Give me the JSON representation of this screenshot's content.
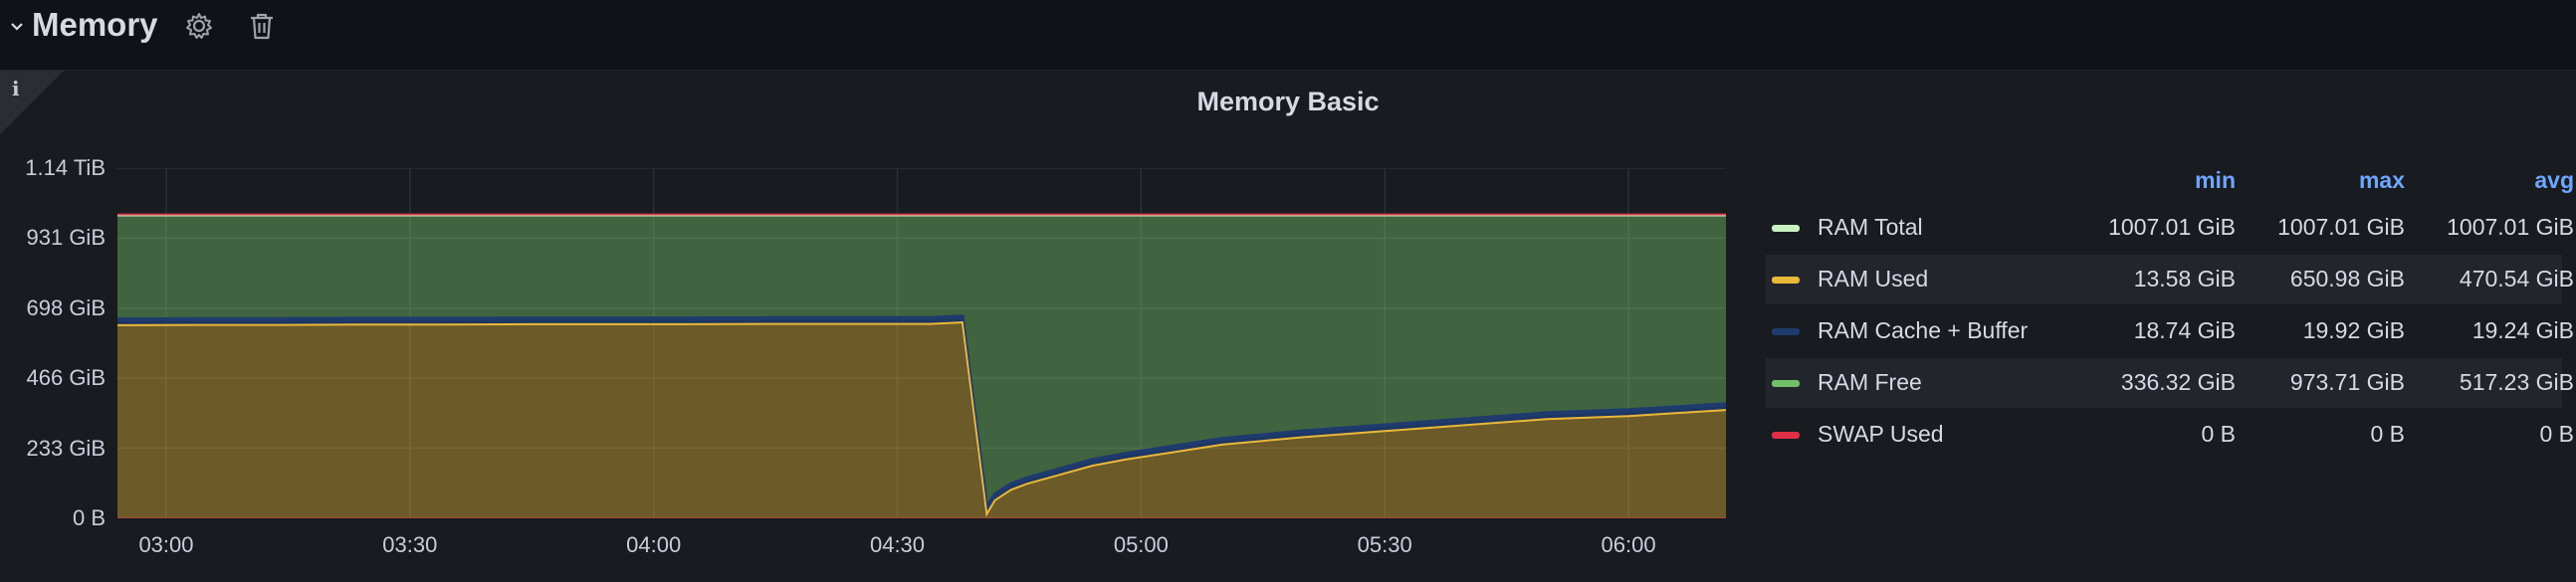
{
  "row": {
    "title": "Memory",
    "collapse_icon": "chevron-down-icon",
    "settings_icon": "gear-icon",
    "delete_icon": "trash-icon"
  },
  "panel": {
    "title": "Memory Basic",
    "info_icon": "info-icon"
  },
  "chart_data": {
    "type": "area",
    "title": "Memory Basic",
    "xlabel": "",
    "ylabel": "",
    "y_ticks": [
      "0 B",
      "233 GiB",
      "466 GiB",
      "698 GiB",
      "931 GiB",
      "1.14 TiB"
    ],
    "y_tick_values": [
      0,
      233,
      466,
      698,
      931,
      1164
    ],
    "ylim": [
      0,
      1164
    ],
    "x_ticks": [
      "03:00",
      "03:30",
      "04:00",
      "04:30",
      "05:00",
      "05:30",
      "06:00"
    ],
    "x_tick_minutes": [
      180,
      210,
      240,
      270,
      300,
      330,
      360
    ],
    "xlim": [
      174,
      372
    ],
    "grid": true,
    "legend_placement": "right-table",
    "x": [
      174,
      184,
      194,
      204,
      214,
      224,
      234,
      244,
      254,
      264,
      274,
      278,
      281,
      282,
      284,
      286,
      290,
      294,
      298,
      304,
      310,
      320,
      330,
      340,
      350,
      360,
      372
    ],
    "series": [
      {
        "name": "RAM Total",
        "color": "#c8f2c2",
        "values": [
          1007.01,
          1007.01,
          1007.01,
          1007.01,
          1007.01,
          1007.01,
          1007.01,
          1007.01,
          1007.01,
          1007.01,
          1007.01,
          1007.01,
          1007.01,
          1007.01,
          1007.01,
          1007.01,
          1007.01,
          1007.01,
          1007.01,
          1007.01,
          1007.01,
          1007.01,
          1007.01,
          1007.01,
          1007.01,
          1007.01,
          1007.01
        ]
      },
      {
        "name": "RAM Used",
        "color": "#eab839",
        "values": [
          642,
          643,
          643,
          644,
          644,
          645,
          645,
          645,
          646,
          646,
          646,
          650.98,
          13.58,
          60,
          95,
          115,
          145,
          175,
          195,
          220,
          245,
          270,
          290,
          310,
          330,
          340,
          360
        ]
      },
      {
        "name": "RAM Cache + Buffer",
        "color": "#1f3b6e",
        "values": [
          19.2,
          19.2,
          19.2,
          19.2,
          19.3,
          19.3,
          19.3,
          19.4,
          19.4,
          19.5,
          19.5,
          19.9,
          18.74,
          18.8,
          18.9,
          19.0,
          19.0,
          19.1,
          19.1,
          19.2,
          19.2,
          19.3,
          19.3,
          19.4,
          19.4,
          19.5,
          19.5
        ]
      },
      {
        "name": "RAM Free",
        "color": "#73bf69",
        "values": [
          346,
          345,
          345,
          344,
          344,
          343,
          343,
          343,
          342,
          342,
          342,
          336.32,
          973.71,
          928,
          893,
          873,
          843,
          813,
          793,
          768,
          743,
          718,
          698,
          678,
          658,
          648,
          628
        ]
      },
      {
        "name": "SWAP Used",
        "color": "#e02f44",
        "values": [
          0,
          0,
          0,
          0,
          0,
          0,
          0,
          0,
          0,
          0,
          0,
          0,
          0,
          0,
          0,
          0,
          0,
          0,
          0,
          0,
          0,
          0,
          0,
          0,
          0,
          0,
          0
        ]
      }
    ]
  },
  "legend": {
    "headers": {
      "min": "min",
      "max": "max",
      "avg": "avg"
    },
    "rows": [
      {
        "name": "RAM Total",
        "color": "#c8f2c2",
        "min": "1007.01 GiB",
        "max": "1007.01 GiB",
        "avg": "1007.01 GiB"
      },
      {
        "name": "RAM Used",
        "color": "#eab839",
        "min": "13.58 GiB",
        "max": "650.98 GiB",
        "avg": "470.54 GiB"
      },
      {
        "name": "RAM Cache + Buffer",
        "color": "#1f3b6e",
        "min": "18.74 GiB",
        "max": "19.92 GiB",
        "avg": "19.24 GiB"
      },
      {
        "name": "RAM Free",
        "color": "#73bf69",
        "min": "336.32 GiB",
        "max": "973.71 GiB",
        "avg": "517.23 GiB"
      },
      {
        "name": "SWAP Used",
        "color": "#e02f44",
        "min": "0 B",
        "max": "0 B",
        "avg": "0 B"
      }
    ]
  }
}
